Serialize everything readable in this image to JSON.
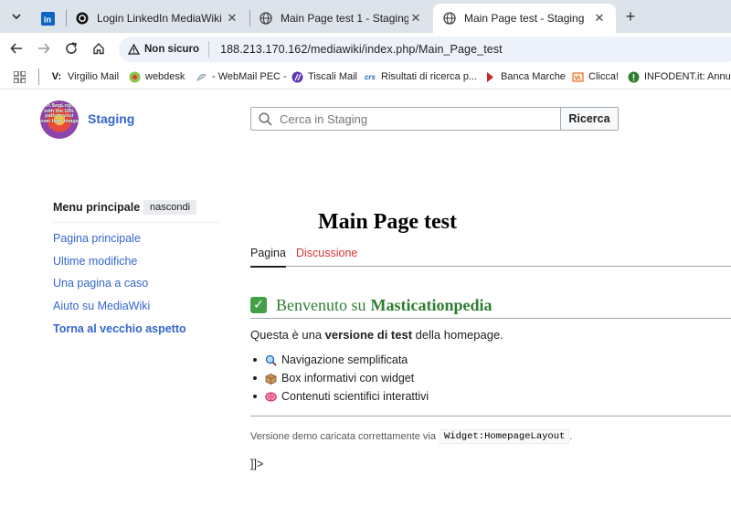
{
  "browser": {
    "tabs": [
      {
        "title": "",
        "icon": "linkedin-icon"
      },
      {
        "title": "Login LinkedIn MediaWiki",
        "icon": "threads-icon"
      },
      {
        "title": "Main Page test 1 - Staging",
        "icon": "globe-icon"
      },
      {
        "title": "Main Page test - Staging",
        "icon": "globe-icon",
        "active": true
      }
    ],
    "security_label": "Non sicuro",
    "url": "188.213.170.162/mediawiki/index.php/Main_Page_test",
    "bookmarks": [
      {
        "label": "Virgilio Mail",
        "icon": "virgilio-icon"
      },
      {
        "label": "webdesk",
        "icon": "webdesk-icon"
      },
      {
        "label": "- WebMail PEC -",
        "icon": "webmail-icon"
      },
      {
        "label": "Tiscali Mail",
        "icon": "tiscali-icon"
      },
      {
        "label": "Risultati di ricerca p...",
        "icon": "crs-icon"
      },
      {
        "label": "Banca Marche",
        "icon": "banca-icon"
      },
      {
        "label": "Clicca!",
        "icon": "clicca-icon"
      },
      {
        "label": "INFODENT.it: Annunc",
        "icon": "infodent-icon"
      }
    ]
  },
  "site": {
    "logo_text": "Set $wgLogos with the URL path to your own logo image",
    "name": "Staging"
  },
  "search": {
    "placeholder": "Cerca in Staging",
    "button": "Ricerca"
  },
  "menu": {
    "heading": "Menu principale",
    "hide": "nascondi",
    "items": [
      {
        "label": "Pagina principale"
      },
      {
        "label": "Ultime modifiche"
      },
      {
        "label": "Una pagina a caso"
      },
      {
        "label": "Aiuto su MediaWiki"
      },
      {
        "label": "Torna al vecchio aspetto"
      }
    ]
  },
  "page": {
    "title": "Main Page test",
    "tabs": [
      "Pagina",
      "Discussione"
    ],
    "welcome_prefix": "Benvenuto su",
    "welcome_brand": "Masticationpedia",
    "intro_a": "Questa è una ",
    "intro_b": "versione di test",
    "intro_c": " della homepage.",
    "bullets": [
      {
        "text": "Navigazione semplificata",
        "icon": "magnifier-icon"
      },
      {
        "text": "Box informativi con widget",
        "icon": "box-icon"
      },
      {
        "text": "Contenuti scientifici interattivi",
        "icon": "brain-icon"
      }
    ],
    "demo_text": "Versione demo caricata correttamente via",
    "demo_code": "Widget:HomepageLayout",
    "demo_end": ".",
    "tail": "]]>"
  },
  "colors": {
    "link": "#3366cc",
    "redlink": "#d73333",
    "heading_green": "#2e7d32"
  }
}
